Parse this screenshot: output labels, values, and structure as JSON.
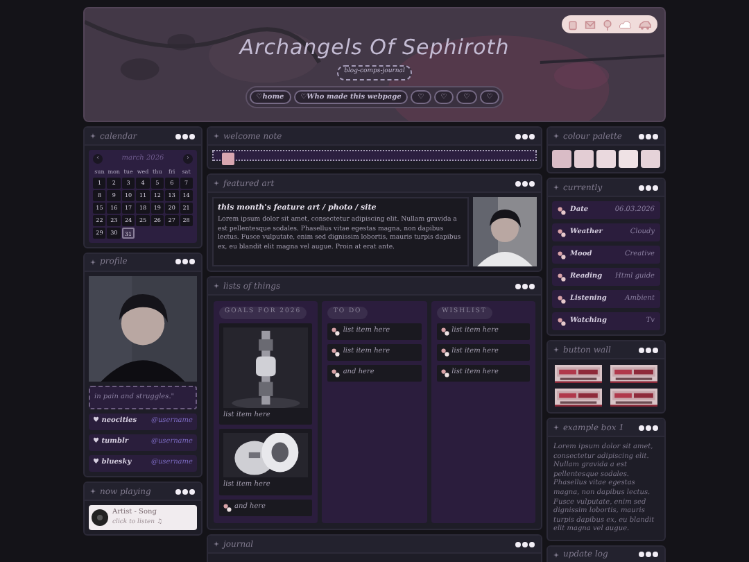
{
  "header": {
    "title": "Archangels Of Sephiroth",
    "subtitle": "blog-comps-journal",
    "nav": [
      "♡home",
      "♡Who made this webpage",
      "♡",
      "♡",
      "♡",
      "♡"
    ]
  },
  "calendar": {
    "title": "calendar",
    "prev": "‹",
    "next": "›",
    "month": "march 2026",
    "weekdays": [
      "sun",
      "mon",
      "tue",
      "wed",
      "thu",
      "fri",
      "sat"
    ],
    "days": [
      {
        "label": "1",
        "selected": false
      },
      {
        "label": "2",
        "selected": false
      },
      {
        "label": "3",
        "selected": false
      },
      {
        "label": "4",
        "selected": false
      },
      {
        "label": "5",
        "selected": false
      },
      {
        "label": "6",
        "selected": false
      },
      {
        "label": "7",
        "selected": false
      },
      {
        "label": "8",
        "selected": false
      },
      {
        "label": "9",
        "selected": false
      },
      {
        "label": "10",
        "selected": false
      },
      {
        "label": "11",
        "selected": false
      },
      {
        "label": "12",
        "selected": false
      },
      {
        "label": "13",
        "selected": false
      },
      {
        "label": "14",
        "selected": false
      },
      {
        "label": "15",
        "selected": false
      },
      {
        "label": "16",
        "selected": false
      },
      {
        "label": "17",
        "selected": false
      },
      {
        "label": "18",
        "selected": false
      },
      {
        "label": "19",
        "selected": false
      },
      {
        "label": "20",
        "selected": false
      },
      {
        "label": "21",
        "selected": false
      },
      {
        "label": "22",
        "selected": false
      },
      {
        "label": "23",
        "selected": false
      },
      {
        "label": "24",
        "selected": false
      },
      {
        "label": "25",
        "selected": false
      },
      {
        "label": "26",
        "selected": false
      },
      {
        "label": "27",
        "selected": false
      },
      {
        "label": "28",
        "selected": false
      },
      {
        "label": "29",
        "selected": false
      },
      {
        "label": "30",
        "selected": false
      },
      {
        "label": "31",
        "selected": true
      }
    ]
  },
  "profile": {
    "title": "profile",
    "quote": "in pain and struggles.\"",
    "links": [
      {
        "site": "♥ neocities",
        "user": "@username"
      },
      {
        "site": "♥ tumblr",
        "user": "@username"
      },
      {
        "site": "♥ bluesky",
        "user": "@username"
      }
    ]
  },
  "now_playing": {
    "title": "now playing",
    "track": "Artist - Song",
    "action": "click to listen ♫"
  },
  "welcome": {
    "title": "welcome note"
  },
  "featured": {
    "title": "featured art",
    "heading": "this month's feature art / photo / site",
    "body": "Lorem ipsum dolor sit amet, consectetur adipiscing elit. Nullam gravida a est pellentesque sodales. Phasellus vitae egestas magna, non dapibus lectus. Fusce vulputate, enim sed dignissim lobortis, mauris turpis dapibus ex, eu blandit elit magna vel augue. Proin at erat ante."
  },
  "lists": {
    "title": "lists of things",
    "columns": [
      {
        "heading": "GOALS FOR 2026",
        "items": [
          {
            "text": "list item here"
          },
          {
            "text": "list item here"
          },
          {
            "kind": "text",
            "text": "and here"
          }
        ]
      },
      {
        "heading": "TO DO",
        "items": [
          {
            "kind": "text",
            "text": "list item here"
          },
          {
            "kind": "text",
            "text": "list item here"
          },
          {
            "kind": "text",
            "text": "and here"
          }
        ]
      },
      {
        "heading": "WISHLIST",
        "items": [
          {
            "kind": "text",
            "text": "list item here"
          },
          {
            "kind": "text",
            "text": "list item here"
          },
          {
            "kind": "text",
            "text": "list item here"
          }
        ]
      }
    ]
  },
  "journal": {
    "title": "journal"
  },
  "palette": {
    "title": "colour palette",
    "swatches": [
      {
        "color": "#d9bcc6"
      },
      {
        "color": "#e3cdd4"
      },
      {
        "color": "#ead9de"
      },
      {
        "color": "#efe2e5"
      },
      {
        "color": "#e6d3d9"
      }
    ]
  },
  "currently": {
    "title": "currently",
    "rows": [
      {
        "label": "Date",
        "value": "06.03.2026"
      },
      {
        "label": "Weather",
        "value": "Cloudy"
      },
      {
        "label": "Mood",
        "value": "Creative"
      },
      {
        "label": "Reading",
        "value": "Html guide"
      },
      {
        "label": "Listening",
        "value": "Ambient"
      },
      {
        "label": "Watching",
        "value": "Tv"
      }
    ]
  },
  "button_wall": {
    "title": "button wall"
  },
  "example_box": {
    "title": "example box 1",
    "body": "Lorem ipsum dolor sit amet, consectetur adipiscing elit. Nullam gravida a est pellentesque sodales. Phasellus vitae egestas magna, non dapibus lectus. Fusce vulputate, enim sed dignissim lobortis, mauris turpis dapibus ex, eu blandit elit magna vel augue."
  },
  "update_log": {
    "title": "update log"
  }
}
